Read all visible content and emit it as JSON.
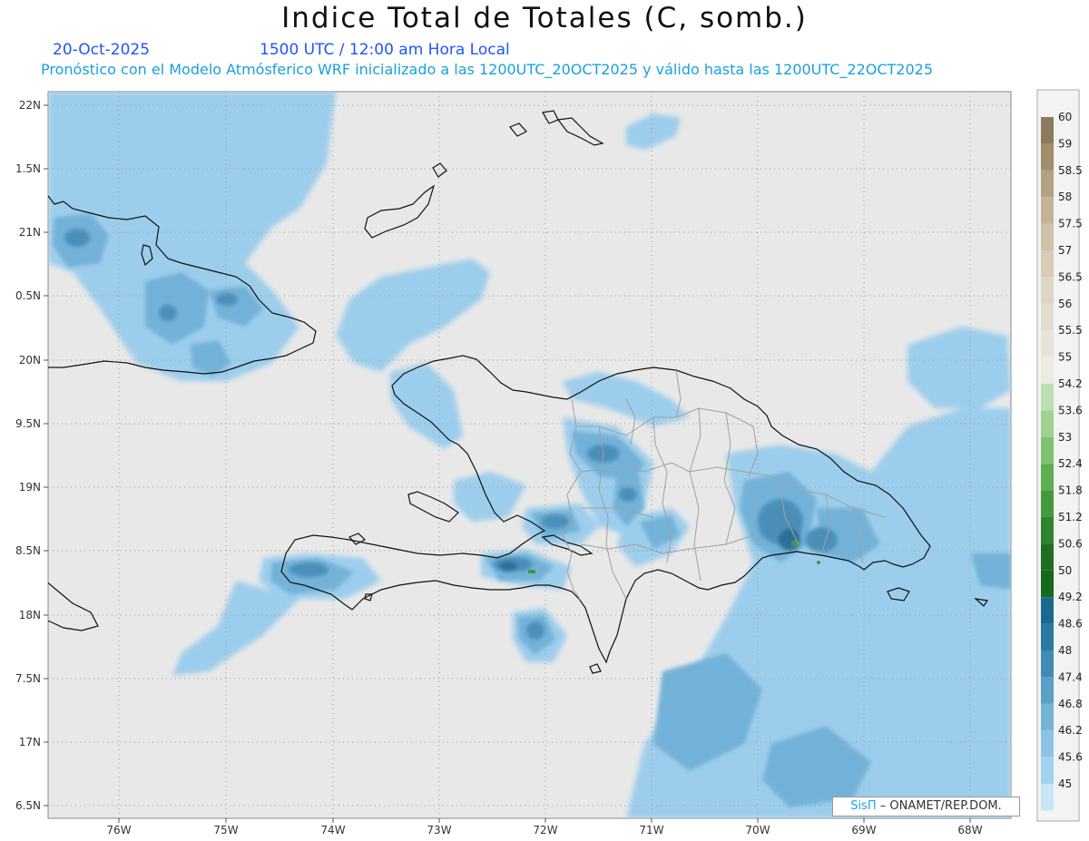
{
  "header": {
    "title": "Indice Total de Totales (C, somb.)",
    "date": "20-Oct-2025",
    "time": "1500 UTC / 12:00 am Hora Local",
    "description": "Pronóstico con el Modelo Atmósferico WRF inicializado a las 1200UTC_20OCT2025 y válido hasta las  1200UTC_22OCT2025"
  },
  "axes": {
    "lat_labels": [
      "22N",
      "1.5N",
      "21N",
      "0.5N",
      "20N",
      "9.5N",
      "19N",
      "8.5N",
      "18N",
      "7.5N",
      "17N",
      "6.5N"
    ],
    "lon_labels": [
      "76W",
      "75W",
      "74W",
      "73W",
      "72W",
      "71W",
      "70W",
      "69W",
      "68W"
    ]
  },
  "colorbar": {
    "labels": [
      "60",
      "59",
      "58.5",
      "58",
      "57.5",
      "57",
      "56.5",
      "56",
      "55.5",
      "55",
      "54.2",
      "53.6",
      "53",
      "52.4",
      "51.8",
      "51.2",
      "50.6",
      "50",
      "49.2",
      "48.6",
      "48",
      "47.4",
      "46.8",
      "46.2",
      "45.6",
      "45"
    ],
    "colors": [
      "#8c7a5a",
      "#a08d6a",
      "#b3a17f",
      "#c2b396",
      "#cdc1a8",
      "#d7ccb7",
      "#ddd5c5",
      "#e2dcd0",
      "#e8e3da",
      "#eeebe3",
      "#bde0b2",
      "#9fd190",
      "#7fc16e",
      "#5fae52",
      "#44993e",
      "#2f8430",
      "#1f6e23",
      "#14691c",
      "#1a6a8f",
      "#2a7aa2",
      "#3e8cb5",
      "#5a9fc6",
      "#74b2d6",
      "#8cc3e3",
      "#a2d2ee",
      "#c9e6f6"
    ]
  },
  "colors": {
    "background": "#e8e8e8",
    "light_shade": "#9ccdec",
    "medium_shade": "#73b2d8",
    "dark_shade": "#4c8fb9",
    "deep_shade": "#2f6e96",
    "green_core": "#3c9a4a",
    "coastline": "#111111",
    "province_lines": "#a0a0a0"
  },
  "credit": {
    "brand": "SisΠ",
    "text": " – ONAMET/REP.DOM."
  }
}
